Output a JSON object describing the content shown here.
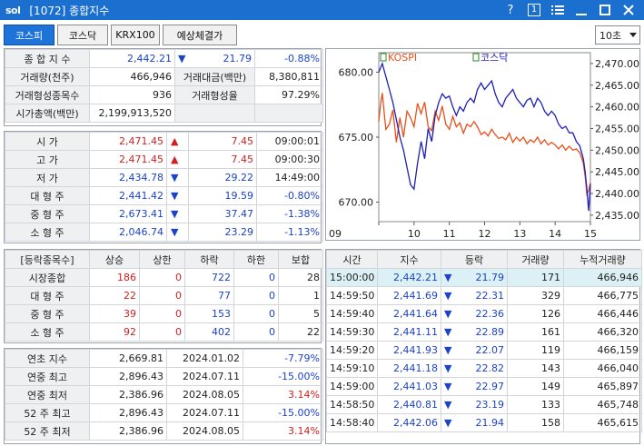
{
  "window": {
    "logo": "sol",
    "title": "[1072] 종합지수",
    "help": "?",
    "page_num": "1"
  },
  "toolbar": {
    "tabs": [
      "코스피",
      "코스닥",
      "KRX100",
      "예상체결가"
    ],
    "interval": "10초"
  },
  "summary": {
    "index_label": "종 합 지 수",
    "index_value": "2,442.21",
    "index_change": "21.79",
    "index_rate": "-0.88%",
    "volume_label": "거래량(천주)",
    "volume_value": "466,946",
    "amount_label": "거래대금(백만)",
    "amount_value": "8,380,811",
    "formed_label": "거래형성종목수",
    "formed_value": "936",
    "formed_rate_label": "거래형성율",
    "formed_rate_value": "97.29%",
    "mcap_label": "시가총액(백만)",
    "mcap_value": "2,199,913,520"
  },
  "prices": [
    {
      "label": "시     가",
      "value": "2,471.45",
      "arrow": "up",
      "change": "7.45",
      "extra": "09:00:01",
      "vcolor": "red"
    },
    {
      "label": "고     가",
      "value": "2,471.45",
      "arrow": "up",
      "change": "7.45",
      "extra": "09:00:30",
      "vcolor": "red"
    },
    {
      "label": "저     가",
      "value": "2,434.78",
      "arrow": "down",
      "change": "29.22",
      "extra": "14:49:00",
      "vcolor": "blue"
    },
    {
      "label": "대 형 주",
      "value": "2,441.42",
      "arrow": "down",
      "change": "19.59",
      "extra": "-0.80%",
      "vcolor": "blue"
    },
    {
      "label": "중 형 주",
      "value": "2,673.41",
      "arrow": "down",
      "change": "37.47",
      "extra": "-1.38%",
      "vcolor": "blue"
    },
    {
      "label": "소 형 주",
      "value": "2,046.74",
      "arrow": "down",
      "change": "23.29",
      "extra": "-1.13%",
      "vcolor": "blue"
    }
  ],
  "breadth": {
    "headers": [
      "[등락종목수]",
      "상승",
      "상한",
      "하락",
      "하한",
      "보합"
    ],
    "rows": [
      {
        "label": "시장종합",
        "up": "186",
        "upper": "0",
        "down": "722",
        "lower": "0",
        "flat": "28"
      },
      {
        "label": "대 형 주",
        "up": "22",
        "upper": "0",
        "down": "77",
        "lower": "0",
        "flat": "1"
      },
      {
        "label": "중 형 주",
        "up": "39",
        "upper": "0",
        "down": "153",
        "lower": "0",
        "flat": "5"
      },
      {
        "label": "소 형 주",
        "up": "92",
        "upper": "0",
        "down": "402",
        "lower": "0",
        "flat": "22"
      }
    ]
  },
  "yearly": [
    {
      "label": "연초  지수",
      "value": "2,669.81",
      "date": "2024.01.02",
      "rate": "-7.79%",
      "rcolor": "blue"
    },
    {
      "label": "연중  최고",
      "value": "2,896.43",
      "date": "2024.07.11",
      "rate": "-15.00%",
      "rcolor": "blue"
    },
    {
      "label": "연중  최저",
      "value": "2,386.96",
      "date": "2024.08.05",
      "rate": "3.14%",
      "rcolor": "red"
    },
    {
      "label": "52 주 최고",
      "value": "2,896.43",
      "date": "2024.07.11",
      "rate": "-15.00%",
      "rcolor": "blue"
    },
    {
      "label": "52 주 최저",
      "value": "2,386.96",
      "date": "2024.08.05",
      "rate": "3.14%",
      "rcolor": "red"
    }
  ],
  "ticks": {
    "headers": [
      "시간",
      "지수",
      "등락",
      "거래량",
      "누적거래량"
    ],
    "rows": [
      {
        "time": "15:00:00",
        "index": "2,442.21",
        "change": "21.79",
        "vol": "171",
        "cum": "466,946"
      },
      {
        "time": "14:59:50",
        "index": "2,441.69",
        "change": "22.31",
        "vol": "329",
        "cum": "466,775"
      },
      {
        "time": "14:59:40",
        "index": "2,441.64",
        "change": "22.36",
        "vol": "126",
        "cum": "466,446"
      },
      {
        "time": "14:59:30",
        "index": "2,441.11",
        "change": "22.89",
        "vol": "161",
        "cum": "466,320"
      },
      {
        "time": "14:59:20",
        "index": "2,441.93",
        "change": "22.07",
        "vol": "119",
        "cum": "466,159"
      },
      {
        "time": "14:59:10",
        "index": "2,441.18",
        "change": "22.82",
        "vol": "143",
        "cum": "466,040"
      },
      {
        "time": "14:59:00",
        "index": "2,441.03",
        "change": "22.97",
        "vol": "149",
        "cum": "465,897"
      },
      {
        "time": "14:58:50",
        "index": "2,440.81",
        "change": "23.19",
        "vol": "133",
        "cum": "465,748"
      },
      {
        "time": "14:58:40",
        "index": "2,442.06",
        "change": "21.94",
        "vol": "158",
        "cum": "465,615"
      }
    ]
  },
  "colors": {
    "titlebar": "#1a6fcf",
    "kospi": "#1f1fb8",
    "kosdaq": "#e8501a",
    "up": "#d21f1f",
    "down": "#1b43c9",
    "highlight": "#dcf1f6"
  },
  "chart_data": {
    "type": "line",
    "legend": [
      "KOSPI",
      "코스닥"
    ],
    "x_ticks": [
      "09",
      "10",
      "11",
      "12",
      "13",
      "14",
      "15"
    ],
    "left_axis": {
      "ticks": [
        "680.00",
        "675.00",
        "670.00"
      ],
      "range": [
        668.5,
        681.5
      ]
    },
    "right_axis": {
      "ticks": [
        "2,470.00",
        "2,465.00",
        "2,460.00",
        "2,455.00",
        "2,450.00",
        "2,445.00",
        "2,440.00",
        "2,435.00"
      ],
      "range": [
        2433.5,
        2472.5
      ]
    },
    "series": [
      {
        "name": "KOSPI",
        "axis": "right",
        "x": [
          9.0,
          9.05,
          9.1,
          9.15,
          9.2,
          9.3,
          9.4,
          9.5,
          9.6,
          9.7,
          9.8,
          9.9,
          10.0,
          10.1,
          10.2,
          10.3,
          10.4,
          10.5,
          10.6,
          10.7,
          10.8,
          10.9,
          11.0,
          11.1,
          11.2,
          11.3,
          11.4,
          11.5,
          11.6,
          11.7,
          11.8,
          11.9,
          12.0,
          12.1,
          12.2,
          12.3,
          12.4,
          12.5,
          12.6,
          12.7,
          12.8,
          12.9,
          13.0,
          13.1,
          13.2,
          13.3,
          13.4,
          13.5,
          13.6,
          13.7,
          13.8,
          13.9,
          14.0,
          14.1,
          14.2,
          14.3,
          14.4,
          14.5,
          14.6,
          14.7,
          14.8,
          14.85,
          14.9,
          14.95,
          15.0
        ],
        "y": [
          2468,
          2469,
          2470,
          2468.5,
          2467,
          2464,
          2461,
          2457,
          2453,
          2450,
          2446,
          2442,
          2441,
          2447,
          2452,
          2448,
          2455,
          2452,
          2458,
          2461,
          2463,
          2462,
          2462.5,
          2460,
          2458,
          2460,
          2459,
          2461,
          2462,
          2461,
          2464,
          2465.5,
          2464,
          2465,
          2466,
          2463,
          2461,
          2460,
          2462,
          2463,
          2464,
          2462,
          2461,
          2460,
          2461.5,
          2462,
          2460,
          2462,
          2461,
          2459,
          2458,
          2459,
          2458,
          2456,
          2455,
          2455.5,
          2454,
          2454,
          2452,
          2451,
          2448,
          2445,
          2441,
          2436,
          2442.21
        ]
      },
      {
        "name": "코스닥",
        "axis": "left",
        "x": [
          9.0,
          9.05,
          9.1,
          9.15,
          9.2,
          9.3,
          9.4,
          9.5,
          9.6,
          9.7,
          9.8,
          9.9,
          10.0,
          10.1,
          10.2,
          10.3,
          10.4,
          10.5,
          10.6,
          10.7,
          10.8,
          10.9,
          11.0,
          11.1,
          11.2,
          11.3,
          11.4,
          11.5,
          11.6,
          11.7,
          11.8,
          11.9,
          12.0,
          12.1,
          12.2,
          12.3,
          12.4,
          12.5,
          12.6,
          12.7,
          12.8,
          12.9,
          13.0,
          13.1,
          13.2,
          13.3,
          13.4,
          13.5,
          13.6,
          13.7,
          13.8,
          13.9,
          14.0,
          14.1,
          14.2,
          14.3,
          14.4,
          14.5,
          14.6,
          14.7,
          14.8,
          14.85,
          14.9,
          14.95,
          15.0
        ],
        "y": [
          676.2,
          677.5,
          678.4,
          677.0,
          675.6,
          676.0,
          677.1,
          674.6,
          676.5,
          675.0,
          677.0,
          676.5,
          675.8,
          677.6,
          676.8,
          677.7,
          675.8,
          675.5,
          677.0,
          676.3,
          677.4,
          676.0,
          675.6,
          676.6,
          675.8,
          676.1,
          675.3,
          676.0,
          675.8,
          676.2,
          675.8,
          675.2,
          675.4,
          675.1,
          675.6,
          675.2,
          674.9,
          675.0,
          674.8,
          675.3,
          674.6,
          675.0,
          674.7,
          675.0,
          674.5,
          674.8,
          674.6,
          675.0,
          674.5,
          674.8,
          674.4,
          674.6,
          674.4,
          674.1,
          674.4,
          674.0,
          674.3,
          674.0,
          674.1,
          673.8,
          673.0,
          672.0,
          670.6,
          670.9,
          671.5
        ]
      }
    ]
  }
}
